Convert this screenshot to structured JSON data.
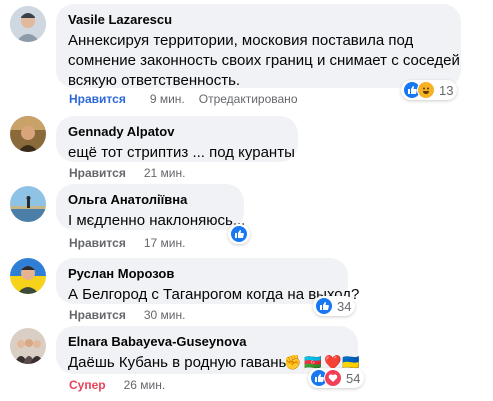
{
  "comments": [
    {
      "author": "Vasile Lazarescu",
      "lines": [
        "Аннексируя территории, московия поставила под",
        "сомнение законность своих границ и снимает с соседей",
        "всякую ответственность."
      ],
      "action": "Нравится",
      "time": "9 мин.",
      "edited": "Отредактировано",
      "reaction_icons": [
        "like-icon",
        "haha-icon"
      ],
      "reaction_count": "13"
    },
    {
      "author": "Gennady Alpatov",
      "lines": [
        "ещё тот стриптиз ... под куранты"
      ],
      "action": "Нравится",
      "time": "21 мин.",
      "reaction_icons": [],
      "reaction_count": ""
    },
    {
      "author": "Ольга Анатоліївна",
      "lines": [
        "І мєдленно наклоняюсь..."
      ],
      "action": "Нравится",
      "time": "17 мин.",
      "reaction_icons": [
        "like-icon"
      ],
      "reaction_count": ""
    },
    {
      "author": "Руслан Морозов",
      "lines": [
        "А Белгород с Таганрогом когда на выход?"
      ],
      "action": "Нравится",
      "time": "30 мин.",
      "reaction_icons": [
        "like-icon"
      ],
      "reaction_count": "34"
    },
    {
      "author": "Elnara Babayeva-Guseynova",
      "lines": [
        "Даёшь Кубань в родную гавань!"
      ],
      "emojis": [
        "✊",
        "🇦🇿",
        "❤️",
        "🇺🇦"
      ],
      "action": "Супер",
      "time": "26 мин.",
      "reaction_icons": [
        "like-icon",
        "love-icon"
      ],
      "reaction_count": "54"
    }
  ],
  "colors": {
    "bubble": "#f0f2f5",
    "like_blue": "#1877f2",
    "super_red": "#e8435a",
    "meta_gray": "#65676b"
  }
}
